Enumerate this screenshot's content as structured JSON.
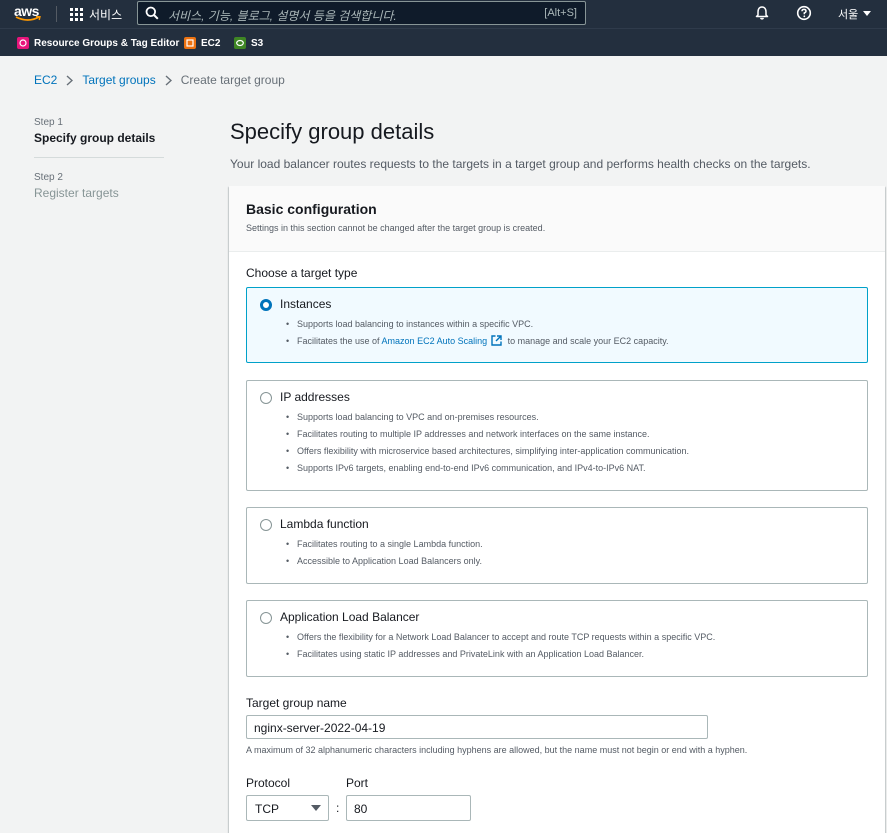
{
  "topnav": {
    "logo": "aws",
    "services_label": "서비스",
    "search_placeholder": "서비스, 기능, 블로그, 설명서 등을 검색합니다.",
    "search_shortcut": "[Alt+S]",
    "region": "서울"
  },
  "favorites": [
    {
      "label": "Resource Groups & Tag Editor",
      "color": "#e7157b"
    },
    {
      "label": "EC2",
      "color": "#ec7211"
    },
    {
      "label": "S3",
      "color": "#3f8624"
    }
  ],
  "breadcrumb": {
    "items": [
      "EC2",
      "Target groups"
    ],
    "current": "Create target group"
  },
  "steps": [
    {
      "num": "Step 1",
      "title": "Specify group details"
    },
    {
      "num": "Step 2",
      "title": "Register targets"
    }
  ],
  "main": {
    "title": "Specify group details",
    "description": "Your load balancer routes requests to the targets in a target group and performs health checks on the targets."
  },
  "basic": {
    "title": "Basic configuration",
    "subtitle": "Settings in this section cannot be changed after the target group is created.",
    "target_type_label": "Choose a target type",
    "options": [
      {
        "title": "Instances",
        "bullets": [
          "Supports load balancing to instances within a specific VPC."
        ],
        "bullet2_prefix": "Facilitates the use of ",
        "bullet2_link": "Amazon EC2 Auto Scaling",
        "bullet2_suffix": " to manage and scale your EC2 capacity."
      },
      {
        "title": "IP addresses",
        "bullets": [
          "Supports load balancing to VPC and on-premises resources.",
          "Facilitates routing to multiple IP addresses and network interfaces on the same instance.",
          "Offers flexibility with microservice based architectures, simplifying inter-application communication.",
          "Supports IPv6 targets, enabling end-to-end IPv6 communication, and IPv4-to-IPv6 NAT."
        ]
      },
      {
        "title": "Lambda function",
        "bullets": [
          "Facilitates routing to a single Lambda function.",
          "Accessible to Application Load Balancers only."
        ]
      },
      {
        "title": "Application Load Balancer",
        "bullets": [
          "Offers the flexibility for a Network Load Balancer to accept and route TCP requests within a specific VPC.",
          "Facilitates using static IP addresses and PrivateLink with an Application Load Balancer."
        ]
      }
    ],
    "name_label": "Target group name",
    "name_value": "nginx-server-2022-04-19",
    "name_hint": "A maximum of 32 alphanumeric characters including hyphens are allowed, but the name must not begin or end with a hyphen.",
    "protocol_label": "Protocol",
    "protocol_value": "TCP",
    "port_label": "Port",
    "port_value": "80",
    "separator": ":"
  }
}
